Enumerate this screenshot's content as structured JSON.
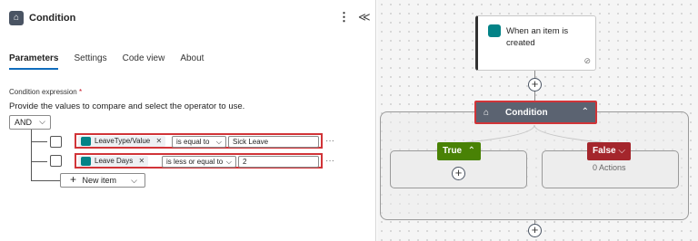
{
  "panel": {
    "title": "Condition",
    "kebab": "⋮",
    "collapse": "≪",
    "tabs": [
      {
        "label": "Parameters",
        "active": true
      },
      {
        "label": "Settings",
        "active": false
      },
      {
        "label": "Code view",
        "active": false
      },
      {
        "label": "About",
        "active": false
      }
    ],
    "condition_label": "Condition expression",
    "required_mark": "*",
    "hint": "Provide the values to compare and select the operator to use.",
    "group_operator": "AND",
    "rows": [
      {
        "token": "LeaveType/Value",
        "operator": "is equal to",
        "value": "Sick Leave"
      },
      {
        "token": "Leave Days",
        "operator": "is less or equal to",
        "value": "2"
      }
    ],
    "new_item_label": "New item",
    "more": "···"
  },
  "canvas": {
    "trigger_title": "When an item is created",
    "condition_title": "Condition",
    "true_label": "True",
    "false_label": "False",
    "false_actions": "0 Actions"
  },
  "colors": {
    "accent_tab": "#0f6cbd",
    "highlight_border": "#d13438",
    "true_green": "#498205",
    "false_red": "#a4262c",
    "condition_node": "#5b6371",
    "sharepoint_teal": "#038387"
  },
  "icons": [
    "condition-icon",
    "sharepoint-icon",
    "link-icon",
    "plus-icon",
    "chevron-down-icon",
    "chevron-up-icon",
    "kebab-icon",
    "collapse-icon"
  ]
}
